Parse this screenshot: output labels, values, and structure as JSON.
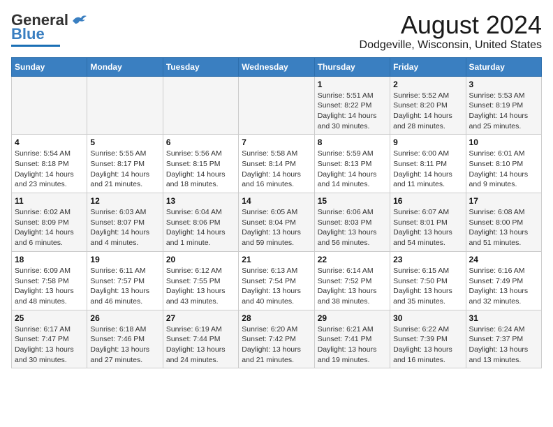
{
  "header": {
    "logo_general": "General",
    "logo_blue": "Blue",
    "title": "August 2024",
    "location": "Dodgeville, Wisconsin, United States"
  },
  "weekdays": [
    "Sunday",
    "Monday",
    "Tuesday",
    "Wednesday",
    "Thursday",
    "Friday",
    "Saturday"
  ],
  "weeks": [
    [
      {
        "day": "",
        "info": ""
      },
      {
        "day": "",
        "info": ""
      },
      {
        "day": "",
        "info": ""
      },
      {
        "day": "",
        "info": ""
      },
      {
        "day": "1",
        "info": "Sunrise: 5:51 AM\nSunset: 8:22 PM\nDaylight: 14 hours\nand 30 minutes."
      },
      {
        "day": "2",
        "info": "Sunrise: 5:52 AM\nSunset: 8:20 PM\nDaylight: 14 hours\nand 28 minutes."
      },
      {
        "day": "3",
        "info": "Sunrise: 5:53 AM\nSunset: 8:19 PM\nDaylight: 14 hours\nand 25 minutes."
      }
    ],
    [
      {
        "day": "4",
        "info": "Sunrise: 5:54 AM\nSunset: 8:18 PM\nDaylight: 14 hours\nand 23 minutes."
      },
      {
        "day": "5",
        "info": "Sunrise: 5:55 AM\nSunset: 8:17 PM\nDaylight: 14 hours\nand 21 minutes."
      },
      {
        "day": "6",
        "info": "Sunrise: 5:56 AM\nSunset: 8:15 PM\nDaylight: 14 hours\nand 18 minutes."
      },
      {
        "day": "7",
        "info": "Sunrise: 5:58 AM\nSunset: 8:14 PM\nDaylight: 14 hours\nand 16 minutes."
      },
      {
        "day": "8",
        "info": "Sunrise: 5:59 AM\nSunset: 8:13 PM\nDaylight: 14 hours\nand 14 minutes."
      },
      {
        "day": "9",
        "info": "Sunrise: 6:00 AM\nSunset: 8:11 PM\nDaylight: 14 hours\nand 11 minutes."
      },
      {
        "day": "10",
        "info": "Sunrise: 6:01 AM\nSunset: 8:10 PM\nDaylight: 14 hours\nand 9 minutes."
      }
    ],
    [
      {
        "day": "11",
        "info": "Sunrise: 6:02 AM\nSunset: 8:09 PM\nDaylight: 14 hours\nand 6 minutes."
      },
      {
        "day": "12",
        "info": "Sunrise: 6:03 AM\nSunset: 8:07 PM\nDaylight: 14 hours\nand 4 minutes."
      },
      {
        "day": "13",
        "info": "Sunrise: 6:04 AM\nSunset: 8:06 PM\nDaylight: 14 hours\nand 1 minute."
      },
      {
        "day": "14",
        "info": "Sunrise: 6:05 AM\nSunset: 8:04 PM\nDaylight: 13 hours\nand 59 minutes."
      },
      {
        "day": "15",
        "info": "Sunrise: 6:06 AM\nSunset: 8:03 PM\nDaylight: 13 hours\nand 56 minutes."
      },
      {
        "day": "16",
        "info": "Sunrise: 6:07 AM\nSunset: 8:01 PM\nDaylight: 13 hours\nand 54 minutes."
      },
      {
        "day": "17",
        "info": "Sunrise: 6:08 AM\nSunset: 8:00 PM\nDaylight: 13 hours\nand 51 minutes."
      }
    ],
    [
      {
        "day": "18",
        "info": "Sunrise: 6:09 AM\nSunset: 7:58 PM\nDaylight: 13 hours\nand 48 minutes."
      },
      {
        "day": "19",
        "info": "Sunrise: 6:11 AM\nSunset: 7:57 PM\nDaylight: 13 hours\nand 46 minutes."
      },
      {
        "day": "20",
        "info": "Sunrise: 6:12 AM\nSunset: 7:55 PM\nDaylight: 13 hours\nand 43 minutes."
      },
      {
        "day": "21",
        "info": "Sunrise: 6:13 AM\nSunset: 7:54 PM\nDaylight: 13 hours\nand 40 minutes."
      },
      {
        "day": "22",
        "info": "Sunrise: 6:14 AM\nSunset: 7:52 PM\nDaylight: 13 hours\nand 38 minutes."
      },
      {
        "day": "23",
        "info": "Sunrise: 6:15 AM\nSunset: 7:50 PM\nDaylight: 13 hours\nand 35 minutes."
      },
      {
        "day": "24",
        "info": "Sunrise: 6:16 AM\nSunset: 7:49 PM\nDaylight: 13 hours\nand 32 minutes."
      }
    ],
    [
      {
        "day": "25",
        "info": "Sunrise: 6:17 AM\nSunset: 7:47 PM\nDaylight: 13 hours\nand 30 minutes."
      },
      {
        "day": "26",
        "info": "Sunrise: 6:18 AM\nSunset: 7:46 PM\nDaylight: 13 hours\nand 27 minutes."
      },
      {
        "day": "27",
        "info": "Sunrise: 6:19 AM\nSunset: 7:44 PM\nDaylight: 13 hours\nand 24 minutes."
      },
      {
        "day": "28",
        "info": "Sunrise: 6:20 AM\nSunset: 7:42 PM\nDaylight: 13 hours\nand 21 minutes."
      },
      {
        "day": "29",
        "info": "Sunrise: 6:21 AM\nSunset: 7:41 PM\nDaylight: 13 hours\nand 19 minutes."
      },
      {
        "day": "30",
        "info": "Sunrise: 6:22 AM\nSunset: 7:39 PM\nDaylight: 13 hours\nand 16 minutes."
      },
      {
        "day": "31",
        "info": "Sunrise: 6:24 AM\nSunset: 7:37 PM\nDaylight: 13 hours\nand 13 minutes."
      }
    ]
  ]
}
